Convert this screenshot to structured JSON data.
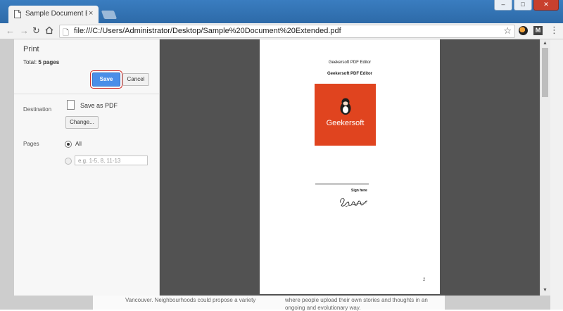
{
  "browser": {
    "tab_title": "Sample Document Extended",
    "tab_close": "×",
    "window_controls": {
      "minimize": "–",
      "maximize": "□",
      "close": "✕"
    },
    "url": "file:///C:/Users/Administrator/Desktop/Sample%20Document%20Extended.pdf",
    "extension_label": "M"
  },
  "print_dialog": {
    "title": "Print",
    "total_label": "Total:",
    "total_value": "5 pages",
    "save_label": "Save",
    "cancel_label": "Cancel",
    "destination_label": "Destination",
    "destination_value": "Save as PDF",
    "change_label": "Change...",
    "pages_label": "Pages",
    "pages_all_label": "All",
    "pages_all_selected": true,
    "pages_custom_placeholder": "e.g. 1-5, 8, 11-13"
  },
  "preview": {
    "header_line1": "Geekersoft PDF Editor",
    "header_line2": "Geekersoft PDF Editor",
    "logo_text": "Geekersoft",
    "sign_label": "Sign here",
    "page_number": "2"
  },
  "background_page": {
    "text_left": "Vancouver. Neighbourhoods could propose a variety",
    "text_right1": "where people upload their own stories and thoughts in an",
    "text_right2": "ongoing and evolutionary way."
  },
  "colors": {
    "accent_blue": "#4a8ee8",
    "highlight_red": "#d0302a",
    "logo_orange": "#e0441f",
    "preview_bg": "#525252"
  }
}
